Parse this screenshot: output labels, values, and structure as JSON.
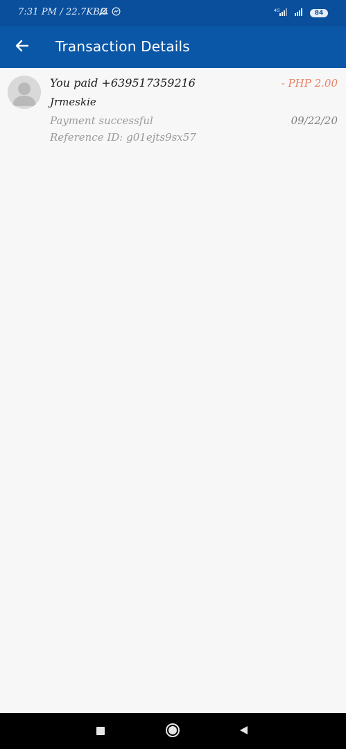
{
  "status_bar": {
    "time": "7:31 PM / 22.7KB/s",
    "battery": "84",
    "icons": [
      "alarm-off-icon",
      "messenger-icon",
      "signal-icon",
      "signal-icon"
    ]
  },
  "app_bar": {
    "title": "Transaction Details",
    "back_icon": "arrow-left-icon"
  },
  "transaction": {
    "title": "You paid +639517359216",
    "name": "Jrmeskie",
    "status": "Payment successful",
    "reference": "Reference ID: g01ejts9sx57",
    "amount": "- PHP 2.00",
    "date": "09/22/20"
  },
  "nav_bar": {
    "buttons": [
      "recents-icon",
      "home-icon",
      "back-icon"
    ]
  },
  "colors": {
    "app_bar": "#0a57a8",
    "status_bar": "#0a4f9c",
    "amount": "#e88063",
    "background": "#f7f7f7"
  }
}
